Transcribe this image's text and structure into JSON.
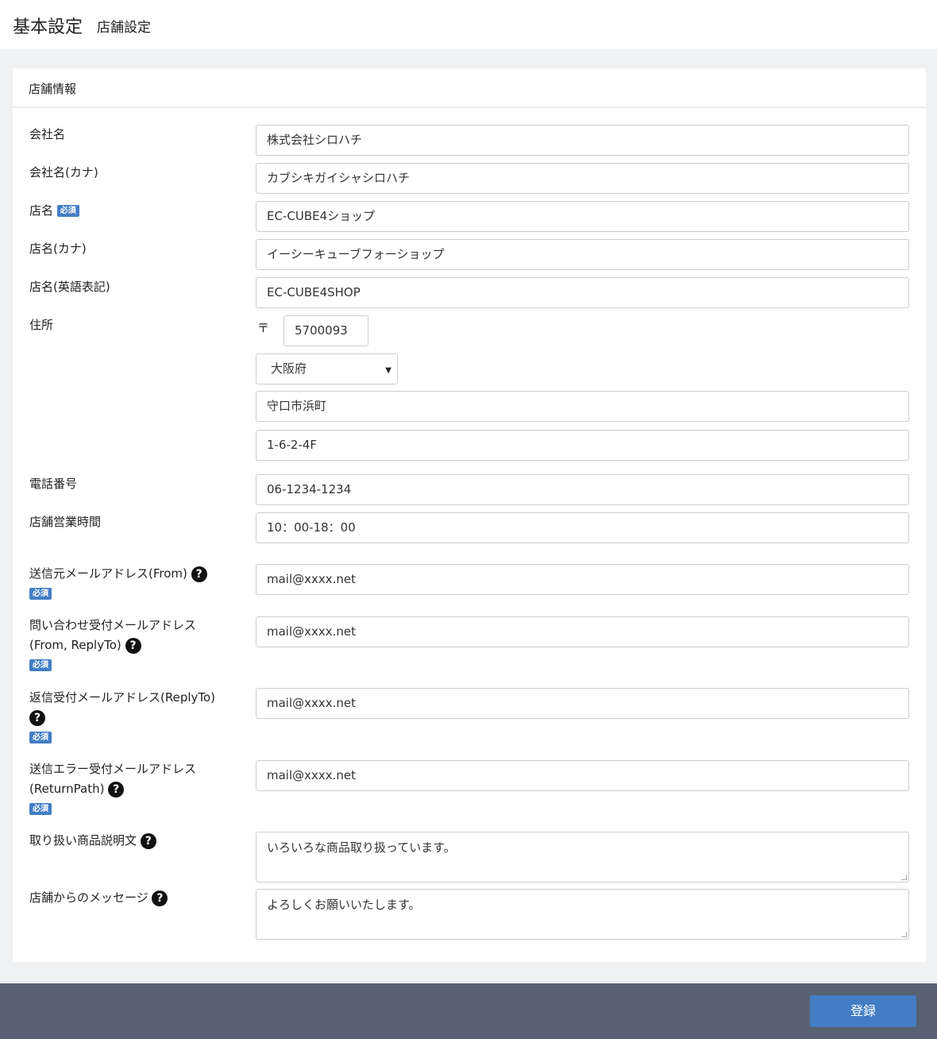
{
  "header": {
    "title": "基本設定",
    "subtitle": "店舗設定"
  },
  "section": {
    "title": "店舗情報"
  },
  "required_badge": "必須",
  "help_icon_glyph": "?",
  "fields": {
    "company_name": {
      "label": "会社名",
      "value": "株式会社シロハチ"
    },
    "company_kana": {
      "label": "会社名(カナ)",
      "value": "カブシキガイシャシロハチ"
    },
    "shop_name": {
      "label": "店名",
      "value": "EC-CUBE4ショップ"
    },
    "shop_kana": {
      "label": "店名(カナ)",
      "value": "イーシーキューブフォーショップ"
    },
    "shop_name_en": {
      "label": "店名(英語表記)",
      "value": "EC-CUBE4SHOP"
    },
    "address": {
      "label": "住所",
      "postal_mark": "〒",
      "postal_code": "5700093",
      "prefecture": "大阪府",
      "city": "守口市浜町",
      "street": "1-6-2-4F"
    },
    "phone": {
      "label": "電話番号",
      "value": "06-1234-1234"
    },
    "business_hours": {
      "label": "店舗営業時間",
      "value": "10：00-18：00"
    },
    "email_from": {
      "label": "送信元メールアドレス(From)",
      "value": "mail@xxxx.net"
    },
    "email_contact": {
      "label_line1": "問い合わせ受付メールアドレス",
      "label_line2": "(From, ReplyTo)",
      "value": "mail@xxxx.net"
    },
    "email_replyto": {
      "label": "返信受付メールアドレス(ReplyTo)",
      "value": "mail@xxxx.net"
    },
    "email_error": {
      "label_line1": "送信エラー受付メールアドレス",
      "label_line2": "(ReturnPath)",
      "value": "mail@xxxx.net"
    },
    "good_traded": {
      "label": "取り扱い商品説明文",
      "value": "いろいろな商品取り扱っています。"
    },
    "message": {
      "label": "店舗からのメッセージ",
      "value": "よろしくお願いいたします。"
    }
  },
  "footer": {
    "submit_label": "登録"
  },
  "colors": {
    "accent": "#437ec4",
    "footer_bg": "#586273",
    "page_bg": "#f0f1f2"
  }
}
